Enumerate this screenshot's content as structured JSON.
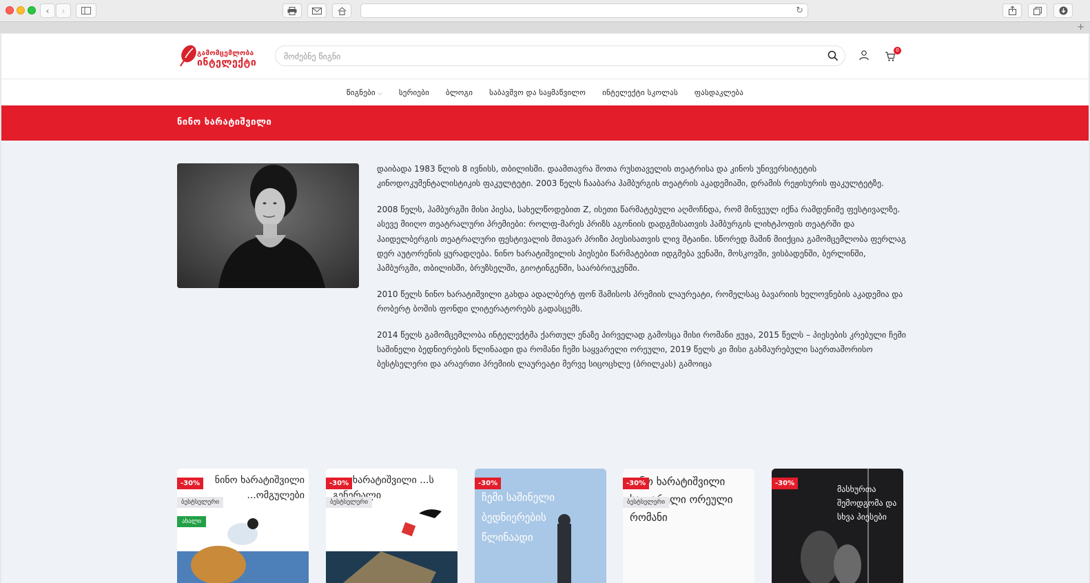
{
  "browser": {
    "address": ""
  },
  "header": {
    "logo_line1": "გამომცემლობა",
    "logo_line2": "ინტელექტი",
    "search_placeholder": "მოძებნე წიგნი",
    "cart_count": "0"
  },
  "nav": {
    "items": [
      "წიგნები",
      "სერიები",
      "ბლოგი",
      "საბავშვო და საყმაწვილო",
      "ინტელექტი სკოლას",
      "ფასდაკლება"
    ]
  },
  "author": {
    "name": "ნინო ხარატიშვილი",
    "bio": [
      "დაიბადა 1983 წლის 8 ივნისს, თბილისში. დაამთავრა შოთა რუსთაველის თეატრისა და კინოს უნივერსიტეტის კინოდოკუმენტალისტიკის ფაკულტეტი. 2003 წელს ჩააბარა ჰამბურგის თეატრის აკადემიაში, დრამის რეჟისურის ფაკულტეტზე.",
      "2008 წელს, ჰამბურგში მისი პიესა, სახელწოდებით Z, ისეთი წარმატებული აღმოჩნდა, რომ მინვეულ იქნა რამდენიმე ფესტივალზე. ასევე მიიღო თეატრალური პრემიები: როლფ-მარეს პრიზს აგონიის დადგმისათვის ჰამბურგის ლიხტჰოფის თეატრში და ჰაიდელბერგის თეატრალური ფესტივალის მთავარ პრიზი პიესისათვის ლივ შტაინი. სწორედ მაშინ მიიქცია გამომცემლობა ფერლაგ დერ აუტორენის ყურადღება. ნინო ხარატიშვილის პიესები წარმატებით იდგმება ვენაში, მოსკოვში, ვისბადენში, ბერლინში, ჰამბურგში, თბილისში, ბრუზსელში, გიოტინგენში, საარბრიუკენში.",
      "2010 წელს ნინო ხარატიშვილი გახდა ადალბერტ ფონ შამისოს პრემიის ლაურეატი, რომელსაც ბავარიის ხელოვნების აკადემია და რობერტ ბოშის ფონდი ლიტერატორებს გადასცემს.",
      "2014 წელს გამომცემლობა ინტელექტმა ქართულ ენაზე პირველად გამოსცა მისი რომანი ჟუჟა, 2015 წელს – პიესების კრებული ჩემი საშინელი ბედნიერების წლინაადი და რომანი ჩემი საყვარელი ორეული, 2019 წელს კი მისი გახმაურებული საერთაშორისო ბესტსელერი და არაერთი პრემიის ლაურეატი მერვე სიცოცხლე (ბრილკას) გამოიცა"
    ]
  },
  "books": [
    {
      "discount": "-30%",
      "bestseller": "ბესტსელერი",
      "new": "ახალი",
      "cover_text": "ნინო ხარატიშვილი ...ომგულები",
      "cover_bg": "#ffffff"
    },
    {
      "discount": "-30%",
      "bestseller": "ბესტსელერი",
      "new": "",
      "cover_text": "...ო ხარატიშვილი ...ს გენერალი",
      "cover_bg": "#ffffff"
    },
    {
      "discount": "-30%",
      "bestseller": "",
      "new": "",
      "cover_text": "ჩემი საშინელი ბედნიერების წლინაადი",
      "cover_bg": "#a9c7e6"
    },
    {
      "discount": "-30%",
      "bestseller": "ბესტსელერი",
      "new": "",
      "cover_text": "...ნო ხარატიშვილი საყვარელი ორეული რომანი",
      "cover_bg": "#fafafa"
    },
    {
      "discount": "-30%",
      "bestseller": "",
      "new": "",
      "cover_text": "მასხურთა შემოდგომა და სხვა პიესები",
      "cover_bg": "#1c1c1e"
    }
  ],
  "colors": {
    "brand_red": "#e31d2a",
    "page_bg": "#eff2f7",
    "badge_green": "#23a046"
  }
}
